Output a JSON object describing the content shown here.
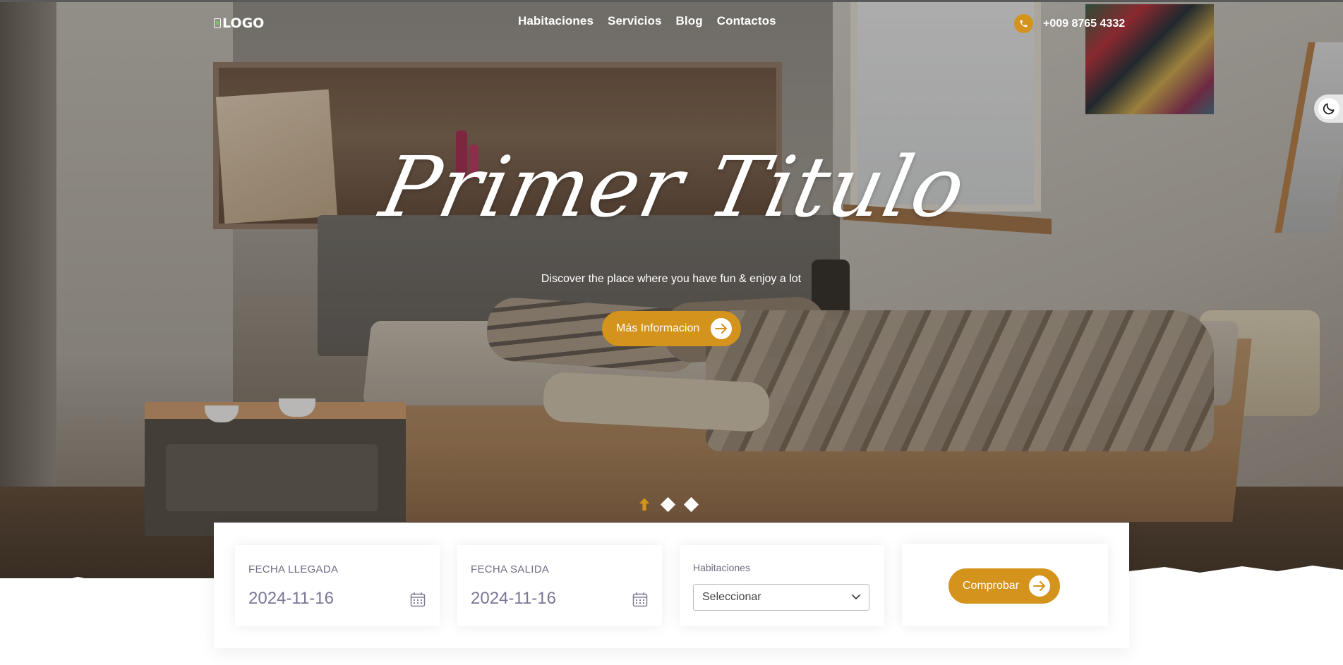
{
  "header": {
    "logo_alt": "LOGO",
    "nav": [
      "Habitaciones",
      "Servicios",
      "Blog",
      "Contactos"
    ],
    "phone": "+009 8765 4332"
  },
  "hero": {
    "title": "Primer Titulo",
    "subtitle": "Discover the place where you have fun & enjoy a lot",
    "button_label": "Más Informacion",
    "slides_total": 3,
    "slide_active": 1
  },
  "booking": {
    "arrival_label": "FECHA LLEGADA",
    "arrival_value": "2024-11-16",
    "departure_label": "FECHA SALIDA",
    "departure_value": "2024-11-16",
    "rooms_label": "Habitaciones",
    "rooms_selected": "Seleccionar",
    "check_button": "Comprobar"
  },
  "colors": {
    "accent": "#d3931c",
    "muted_text": "#787796"
  },
  "icons": [
    "phone-icon",
    "moon-icon",
    "arrow-right-icon",
    "calendar-icon",
    "chevron-down-icon",
    "arrow-up-icon"
  ]
}
